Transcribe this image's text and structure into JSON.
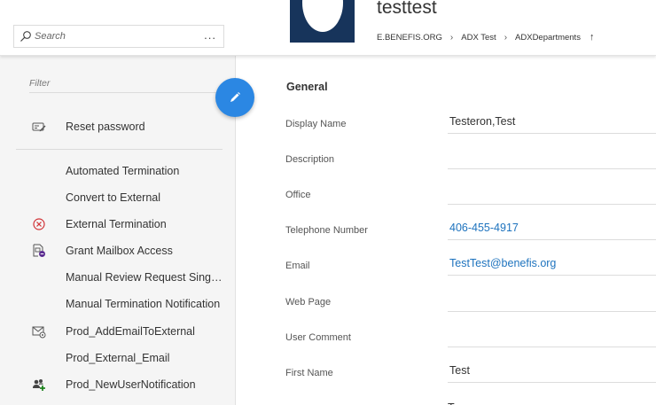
{
  "header": {
    "search": {
      "placeholder": "Search",
      "more_label": "..."
    },
    "title": "testtest",
    "breadcrumb": [
      "E.BENEFIS.ORG",
      "ADX Test",
      "ADXDepartments"
    ],
    "breadcrumb_up_icon": "arrow-up-icon"
  },
  "sidebar": {
    "filter_placeholder": "Filter",
    "primary_action": {
      "label": "Reset password",
      "icon": "keyboard-pen-icon"
    },
    "actions": [
      {
        "label": "Automated Termination",
        "icon": ""
      },
      {
        "label": "Convert to External",
        "icon": ""
      },
      {
        "label": "External Termination",
        "icon": "circle-x-icon"
      },
      {
        "label": "Grant Mailbox Access",
        "icon": "mailbox-access-icon"
      },
      {
        "label": "Manual Review Request Single...",
        "icon": ""
      },
      {
        "label": "Manual Termination Notification",
        "icon": ""
      },
      {
        "label": "Prod_AddEmailToExternal",
        "icon": "envelope-gear-icon"
      },
      {
        "label": "Prod_External_Email",
        "icon": ""
      },
      {
        "label": "Prod_NewUserNotification",
        "icon": "users-add-icon"
      }
    ]
  },
  "fab": {
    "icon": "pencil-icon"
  },
  "form": {
    "section_title": "General",
    "fields": [
      {
        "label": "Display Name",
        "value": "Testeron,Test"
      },
      {
        "label": "Description",
        "value": ""
      },
      {
        "label": "Office",
        "value": ""
      },
      {
        "label": "Telephone Number",
        "value": "406-455-4917"
      },
      {
        "label": "Email",
        "value": "TestTest@benefis.org"
      },
      {
        "label": "Web Page",
        "value": ""
      },
      {
        "label": "User Comment",
        "value": ""
      },
      {
        "label": "First Name",
        "value": "Test"
      }
    ],
    "partial_value": "T"
  },
  "colors": {
    "accent": "#2b87e3",
    "link": "#1e73be",
    "avatar_bg": "#17345b",
    "error_red": "#d13438",
    "panel_bg": "#f5f5f5"
  }
}
